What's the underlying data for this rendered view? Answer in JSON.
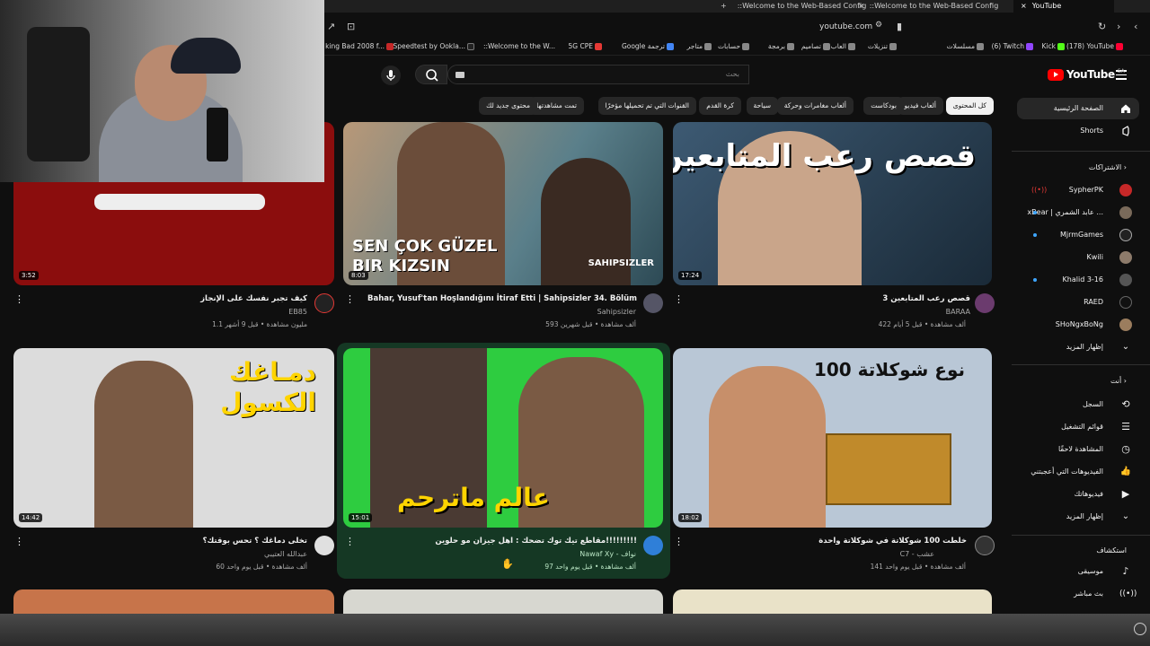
{
  "browser": {
    "tabs": [
      {
        "label": "YouTube",
        "active": true
      },
      {
        "label": "::Welcome to the Web-Based Config",
        "active": false
      },
      {
        "label": "::Welcome to the Web-Based Config",
        "active": false
      }
    ],
    "url": "youtube.com",
    "bookmarks": [
      "(178) YouTube",
      "Kick",
      "(6) Twitch",
      "مسلسلات",
      "تنزيلات",
      "العاب",
      "تصاميم",
      "برمجة",
      "حسابات",
      "متاجر",
      "Google ترجمة",
      "5G CPE",
      "::Welcome to the W...",
      "Speedtest by Ookla...",
      "king Bad 2008 f..."
    ]
  },
  "header": {
    "logo": "YouTube",
    "logo_country": "SA",
    "search_placeholder": "بحث"
  },
  "chips": [
    "كل المحتوى",
    "ألعاب فيديو",
    "بودكاست",
    "ألعاب مغامرات وحركة",
    "سياحة",
    "كرة القدم",
    "القنوات التي تم تحميلها مؤخرًا",
    "تمت مشاهدتها",
    "محتوى جديد لك"
  ],
  "sidebar": {
    "home": "الصفحة الرئيسية",
    "shorts": "Shorts",
    "subs_header": "الاشتراكات",
    "subs": [
      "SypherPK",
      "xBear | عابد الشمري ...",
      "MjrmGames",
      "Kwili",
      "Khalid 3-16",
      "RAED",
      "SHoNgxBoNg"
    ],
    "show_more": "إظهار المزيد",
    "you_header": "أنت",
    "you": [
      "السجل",
      "قوائم التشغيل",
      "المشاهدة لاحقًا",
      "الفيديوهات التي أعجبتني",
      "فيديوهاتك",
      "إظهار المزيد"
    ],
    "explore_header": "استكشاف",
    "explore": [
      "موسيقى",
      "بث مباشر"
    ]
  },
  "videos": [
    {
      "title": "قصص رعب المتابعين 3",
      "channel": "BARAA",
      "meta": "422 ألف مشاهدة • قبل 5 أيام",
      "duration": "17:24",
      "thumb_text": "قصص رعب المتابعين 3"
    },
    {
      "title": "Bahar, Yusuf'tan Hoşlandığını İtiraf Etti | Sahipsizler 34. Bölüm",
      "channel": "Sahipsizler",
      "meta": "593 ألف مشاهدة • قبل شهرين",
      "duration": "8:03",
      "thumb_text": "SEN ÇOK GÜZEL BIR KIZSIN",
      "thumb_brand": "SAHIPSIZLER"
    },
    {
      "title": "كيف تجبر نفسك على الإنجاز",
      "channel": "EB85",
      "meta": "1.1 مليون مشاهدة • قبل 9 أشهر",
      "duration": "3:52"
    },
    {
      "title": "خلطت 100 شوكلاتة في شوكلاتة واحدة",
      "channel": "C7 - عشب",
      "meta": "141 ألف مشاهدة • قبل يوم واحد",
      "duration": "18:02",
      "thumb_text": "100 نوع شوكلاتة"
    },
    {
      "title": "مقاطع تيك توك تضحك : اهل جيزان مو حلوين!!!!!!!!!",
      "channel": "Nawaf Xy - نواف",
      "meta": "97 ألف مشاهدة • قبل يوم واحد",
      "duration": "15:01",
      "thumb_text": "عالم ماترحم"
    },
    {
      "title": "تخلى دماغك ؟ تحس بوقتك؟",
      "channel": "عبدالله العتيبي",
      "meta": "60 ألف مشاهدة • قبل يوم واحد",
      "duration": "14:42",
      "thumb_text": "دمـاغك الكسول"
    }
  ]
}
